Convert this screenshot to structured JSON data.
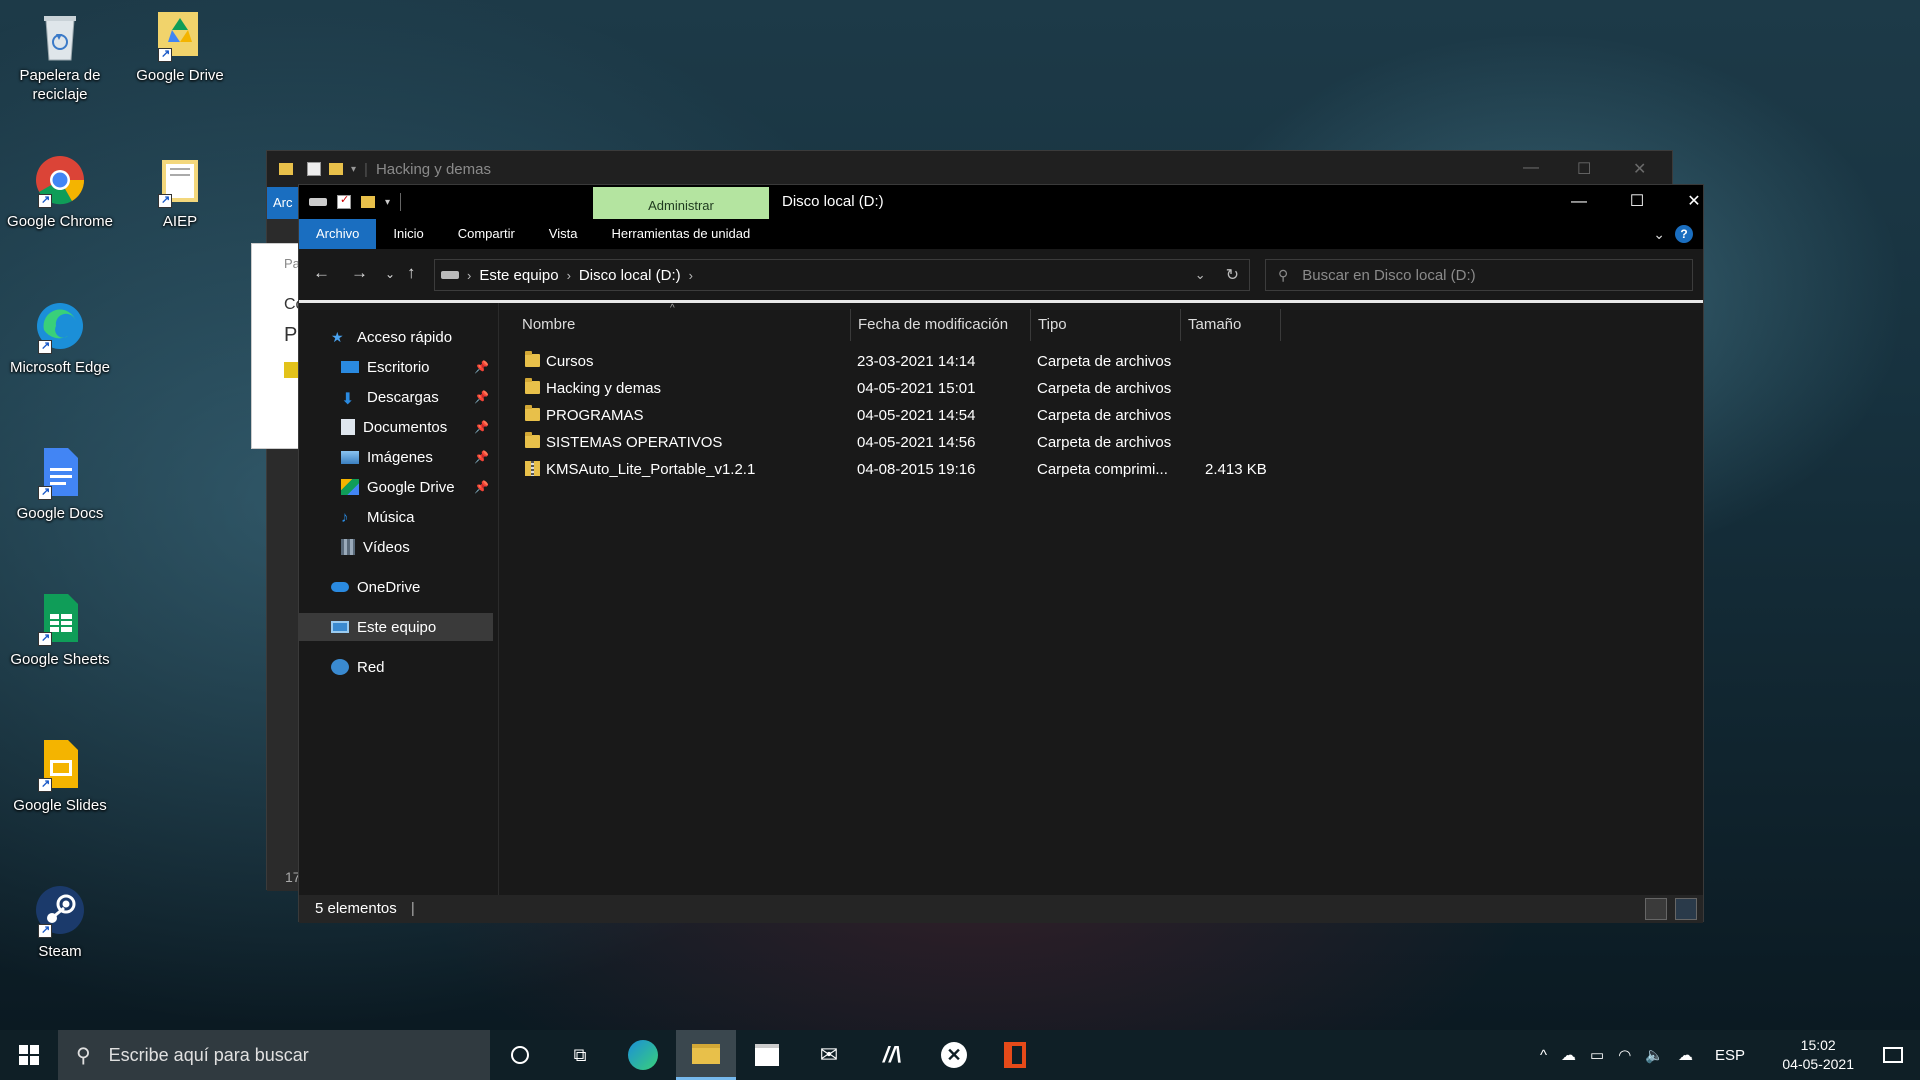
{
  "desktop_icons": [
    {
      "label": "Papelera de reciclaje",
      "icon": "recycle-bin-icon"
    },
    {
      "label": "Google Drive",
      "icon": "google-drive-icon"
    },
    {
      "label": "Google Chrome",
      "icon": "chrome-icon"
    },
    {
      "label": "AIEP",
      "icon": "folder-icon"
    },
    {
      "label": "Microsoft Edge",
      "icon": "edge-icon"
    },
    {
      "label": "Google Docs",
      "icon": "docs-icon"
    },
    {
      "label": "Google Sheets",
      "icon": "sheets-icon"
    },
    {
      "label": "Google Slides",
      "icon": "slides-icon"
    },
    {
      "label": "Steam",
      "icon": "steam-icon"
    }
  ],
  "back_window": {
    "title": "Hacking y demas",
    "tab": "Arc",
    "panel_t1": "Pa",
    "panel_t2": "Co",
    "panel_t3": "Pa",
    "number": "17"
  },
  "window": {
    "title": "Disco local (D:)",
    "contextual_tab": "Administrar",
    "ribbon_tabs": [
      "Archivo",
      "Inicio",
      "Compartir",
      "Vista",
      "Herramientas de unidad"
    ],
    "breadcrumb": [
      "Este equipo",
      "Disco local (D:)"
    ],
    "search_placeholder": "Buscar en Disco local (D:)",
    "sidebar": [
      {
        "label": "Acceso rápido",
        "icon": "star-icon",
        "pinned": false
      },
      {
        "label": "Escritorio",
        "icon": "desktop-icon",
        "pinned": true
      },
      {
        "label": "Descargas",
        "icon": "download-icon",
        "pinned": true
      },
      {
        "label": "Documentos",
        "icon": "document-icon",
        "pinned": true
      },
      {
        "label": "Imágenes",
        "icon": "image-icon",
        "pinned": true
      },
      {
        "label": "Google Drive",
        "icon": "google-drive-icon",
        "pinned": true
      },
      {
        "label": "Música",
        "icon": "music-icon",
        "pinned": false
      },
      {
        "label": "Vídeos",
        "icon": "video-icon",
        "pinned": false
      },
      {
        "label": "OneDrive",
        "icon": "cloud-icon",
        "pinned": false
      },
      {
        "label": "Este equipo",
        "icon": "computer-icon",
        "pinned": false
      },
      {
        "label": "Red",
        "icon": "network-icon",
        "pinned": false
      }
    ],
    "columns": [
      "Nombre",
      "Fecha de modificación",
      "Tipo",
      "Tamaño"
    ],
    "files": [
      {
        "name": "Cursos",
        "date": "23-03-2021 14:14",
        "type": "Carpeta de archivos",
        "size": "",
        "kind": "folder"
      },
      {
        "name": "Hacking y demas",
        "date": "04-05-2021 15:01",
        "type": "Carpeta de archivos",
        "size": "",
        "kind": "folder"
      },
      {
        "name": "PROGRAMAS",
        "date": "04-05-2021 14:54",
        "type": "Carpeta de archivos",
        "size": "",
        "kind": "folder"
      },
      {
        "name": "SISTEMAS OPERATIVOS",
        "date": "04-05-2021 14:56",
        "type": "Carpeta de archivos",
        "size": "",
        "kind": "folder"
      },
      {
        "name": "KMSAuto_Lite_Portable_v1.2.1",
        "date": "04-08-2015 19:16",
        "type": "Carpeta comprimi...",
        "size": "2.413 KB",
        "kind": "zip"
      }
    ],
    "status": "5 elementos"
  },
  "taskbar": {
    "search_placeholder": "Escribe aquí para buscar",
    "language": "ESP",
    "time": "15:02",
    "date": "04-05-2021"
  },
  "colors": {
    "accent": "#1a6ec0",
    "admin_tab": "#b4e4a0",
    "folder": "#e8c04a"
  }
}
